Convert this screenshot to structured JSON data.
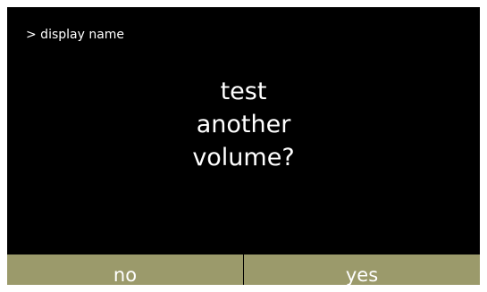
{
  "breadcrumb": "> display name",
  "prompt": {
    "lines": [
      "test",
      "another",
      "volume?"
    ]
  },
  "buttons": {
    "no_label": "no",
    "yes_label": "yes"
  },
  "colors": {
    "background": "#000000",
    "button": "#9b9a6b",
    "text": "#ffffff"
  }
}
